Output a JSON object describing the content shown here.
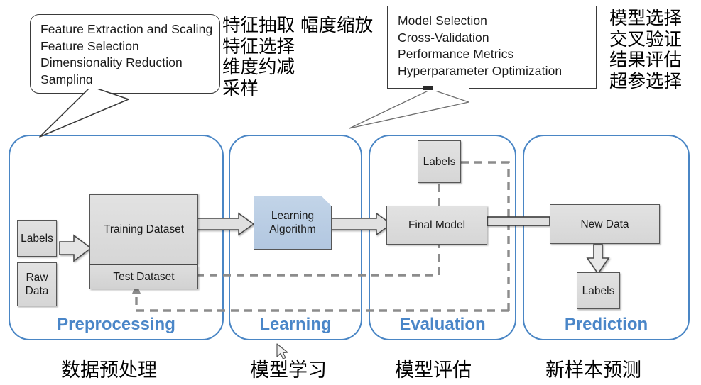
{
  "callouts": [
    {
      "id": "preprocessing-callout",
      "lines": [
        "Feature Extraction and Scaling",
        "Feature Selection",
        "Dimensionality Reduction",
        "Sampling"
      ]
    },
    {
      "id": "evaluation-callout",
      "lines": [
        "Model Selection",
        "Cross-Validation",
        "Performance Metrics",
        "Hyperparameter Optimization"
      ]
    }
  ],
  "annotations": {
    "left": [
      "特征抽取 幅度缩放",
      "特征选择",
      "维度约减",
      "采样"
    ],
    "right": [
      "模型选择",
      "交叉验证",
      "结果评估",
      "超参选择"
    ]
  },
  "stages": [
    {
      "id": "preprocessing",
      "label": "Preprocessing",
      "caption": "数据预处理"
    },
    {
      "id": "learning",
      "label": "Learning",
      "caption": "模型学习"
    },
    {
      "id": "evaluation",
      "label": "Evaluation",
      "caption": "模型评估"
    },
    {
      "id": "prediction",
      "label": "Prediction",
      "caption": "新样本预测"
    }
  ],
  "nodes": {
    "labels_input": "Labels",
    "raw_data": "Raw\nData",
    "raw_data_line1": "Raw",
    "raw_data_line2": "Data",
    "training_dataset": "Training Dataset",
    "test_dataset": "Test Dataset",
    "learning_algorithm_line1": "Learning",
    "learning_algorithm_line2": "Algorithm",
    "eval_labels": "Labels",
    "final_model": "Final Model",
    "new_data": "New Data",
    "predicted_labels": "Labels"
  },
  "colors": {
    "panel_border": "#4a86c5",
    "panel_label": "#4a86c8",
    "node_fill": "#dcdcdc",
    "node_border": "#565656",
    "algorithm_fill": "#b9cde4",
    "dashed_line": "#8c8c8c",
    "callout_border": "#3a3a3a"
  }
}
